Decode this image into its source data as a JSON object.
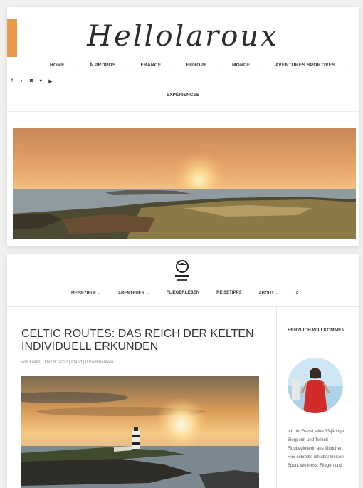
{
  "card1": {
    "logo": "Hellolaroux",
    "nav": [
      "HOME",
      "À PROPOS",
      "FRANCE",
      "EUROPE",
      "MONDE",
      "AVENTURES SPORTIVES"
    ],
    "nav_second_row": "EXPÉRIENCES",
    "social_icons": [
      "facebook-icon",
      "twitter-icon",
      "instagram-icon",
      "pinterest-icon",
      "youtube-icon"
    ]
  },
  "card2": {
    "nav": [
      "REISEZIELE",
      "ABENTEUER",
      "FLIEGERLEBEN",
      "REISETIPPS",
      "ABOUT"
    ],
    "post_title": "CELTIC ROUTES: DAS REICH DER KELTEN INDIVIDUELL ERKUNDEN",
    "meta": "von Fransi | Dez 8, 2022 | Irland | 0 Kommentare",
    "widget_title": "HERZLICH WILLKOMMEN",
    "bio": "Ich bin Fransi, eine 33-jährige Bloggerin und Teilzeit-Flugbegleiterin aus München. Hier schreibe ich über Reisen, Sport, Wellness, Fliegen und"
  },
  "colors": {
    "accent": "#e79a47",
    "text": "#333333"
  }
}
